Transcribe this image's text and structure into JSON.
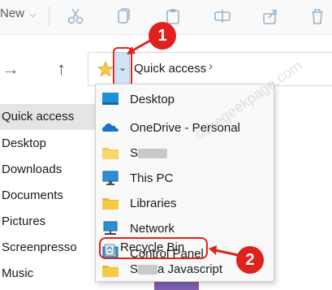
{
  "toolbar": {
    "new_label": "New"
  },
  "address": {
    "crumb": "Quick access"
  },
  "sidebar": {
    "items": [
      {
        "label": "Quick access"
      },
      {
        "label": "Desktop"
      },
      {
        "label": "Downloads"
      },
      {
        "label": "Documents"
      },
      {
        "label": "Pictures"
      },
      {
        "label": "Screenpresso"
      },
      {
        "label": "Music"
      }
    ]
  },
  "menu": {
    "items": [
      {
        "label": "Desktop",
        "icon": "desktop-icon"
      },
      {
        "label": "OneDrive - Personal",
        "icon": "onedrive-icon"
      },
      {
        "label": "S",
        "icon": "user-folder-icon"
      },
      {
        "label": "This PC",
        "icon": "this-pc-icon"
      },
      {
        "label": "Libraries",
        "icon": "libraries-icon"
      },
      {
        "label": "Network",
        "icon": "network-icon"
      },
      {
        "label": "Control Panel",
        "icon": "control-panel-icon"
      },
      {
        "label": "Recycle Bin",
        "icon": "recycle-bin-icon"
      },
      {
        "label": "S",
        "label_suffix": "a Javascript",
        "icon": "folder-icon"
      }
    ]
  },
  "annotations": {
    "step1": "1",
    "step2": "2"
  },
  "watermark": "©thegeekpage.com",
  "colors": {
    "accent_red": "#e0221c",
    "folder_yellow": "#f7c948",
    "selection_blue": "#cfe3f5"
  }
}
